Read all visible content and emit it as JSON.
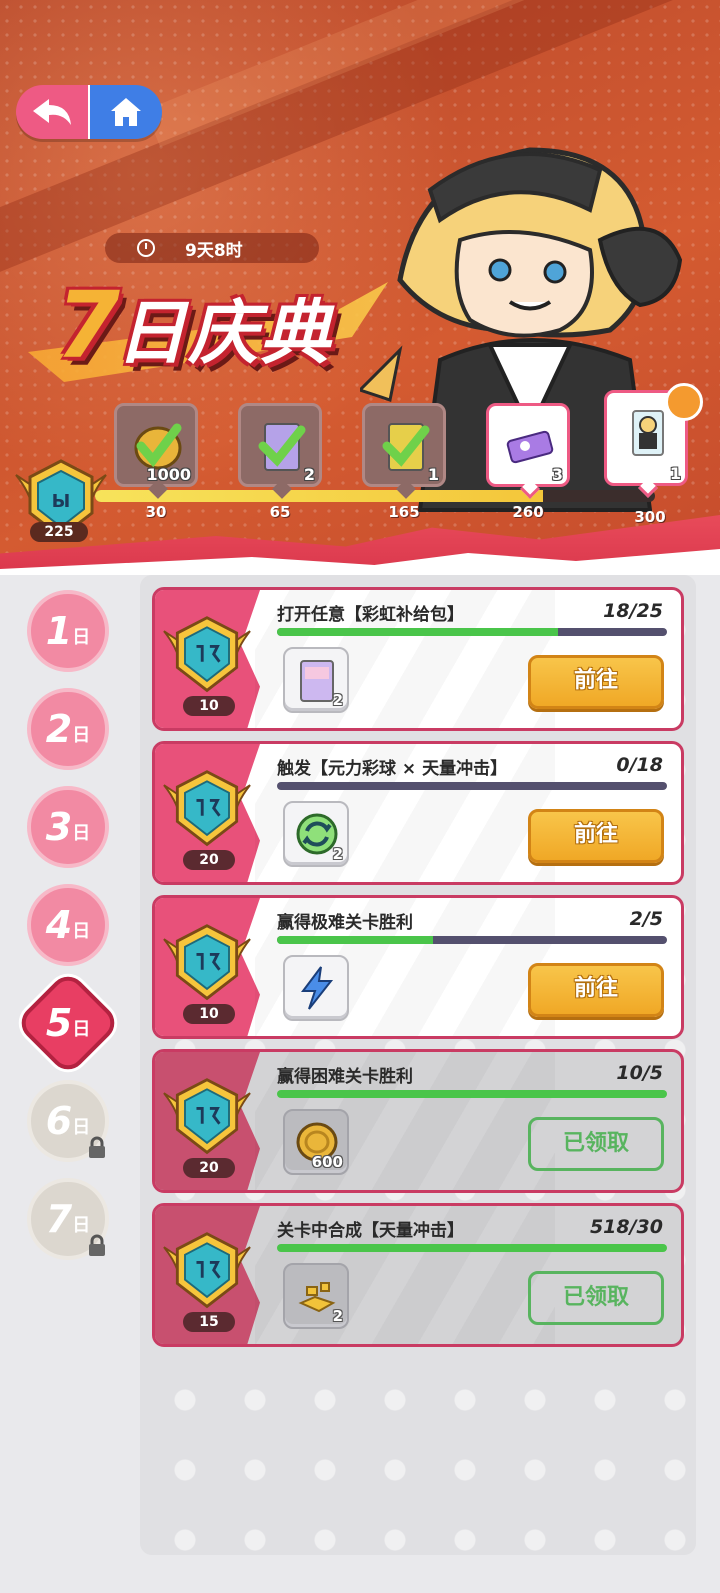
{
  "timer": {
    "text": "9天8时"
  },
  "title": {
    "seven": "7",
    "rest": "日庆典"
  },
  "milestone_points": "225",
  "milestone_progress": 0.8,
  "milestones": [
    {
      "threshold": "30",
      "qty": "1000",
      "icon": "coin-icon",
      "claimed": true
    },
    {
      "threshold": "65",
      "qty": "2",
      "icon": "rainbow-pack-icon",
      "claimed": true
    },
    {
      "threshold": "165",
      "qty": "1",
      "icon": "gift-box-icon",
      "claimed": true
    },
    {
      "threshold": "260",
      "qty": "3",
      "icon": "ticket-icon",
      "claimed": false
    },
    {
      "threshold": "300",
      "qty": "1",
      "icon": "character-card-icon",
      "claimed": false
    }
  ],
  "days": [
    {
      "num": "1",
      "suffix": "日",
      "state": "normal"
    },
    {
      "num": "2",
      "suffix": "日",
      "state": "normal"
    },
    {
      "num": "3",
      "suffix": "日",
      "state": "normal"
    },
    {
      "num": "4",
      "suffix": "日",
      "state": "normal"
    },
    {
      "num": "5",
      "suffix": "日",
      "state": "active"
    },
    {
      "num": "6",
      "suffix": "日",
      "state": "locked"
    },
    {
      "num": "7",
      "suffix": "日",
      "state": "locked"
    }
  ],
  "tasks": [
    {
      "title": "打开任意【彩虹补给包】",
      "count": "18/25",
      "progress": 0.72,
      "points": "10",
      "item_qty": "2",
      "item_icon": "rainbow-pack-icon",
      "button": "前往",
      "claimed": false
    },
    {
      "title": "触发【元力彩球 × 天量冲击】",
      "count": "0/18",
      "progress": 0.0,
      "points": "20",
      "item_qty": "2",
      "item_icon": "refresh-orb-icon",
      "button": "前往",
      "claimed": false
    },
    {
      "title": "赢得极难关卡胜利",
      "count": "2/5",
      "progress": 0.4,
      "points": "10",
      "item_qty": "",
      "item_icon": "lightning-icon",
      "button": "前往",
      "claimed": false
    },
    {
      "title": "赢得困难关卡胜利",
      "count": "10/5",
      "progress": 1.0,
      "points": "20",
      "item_qty": "600",
      "item_icon": "coin-icon",
      "button": "已领取",
      "claimed": true
    },
    {
      "title": "关卡中合成【天量冲击】",
      "count": "518/30",
      "progress": 1.0,
      "points": "15",
      "item_qty": "2",
      "item_icon": "gold-pieces-icon",
      "button": "已领取",
      "claimed": true
    }
  ],
  "colors": {
    "accent_pink": "#e8517a",
    "go_yellow": "#f0a826",
    "claimed_green": "#58b45f",
    "progress_green": "#4ac54a"
  }
}
